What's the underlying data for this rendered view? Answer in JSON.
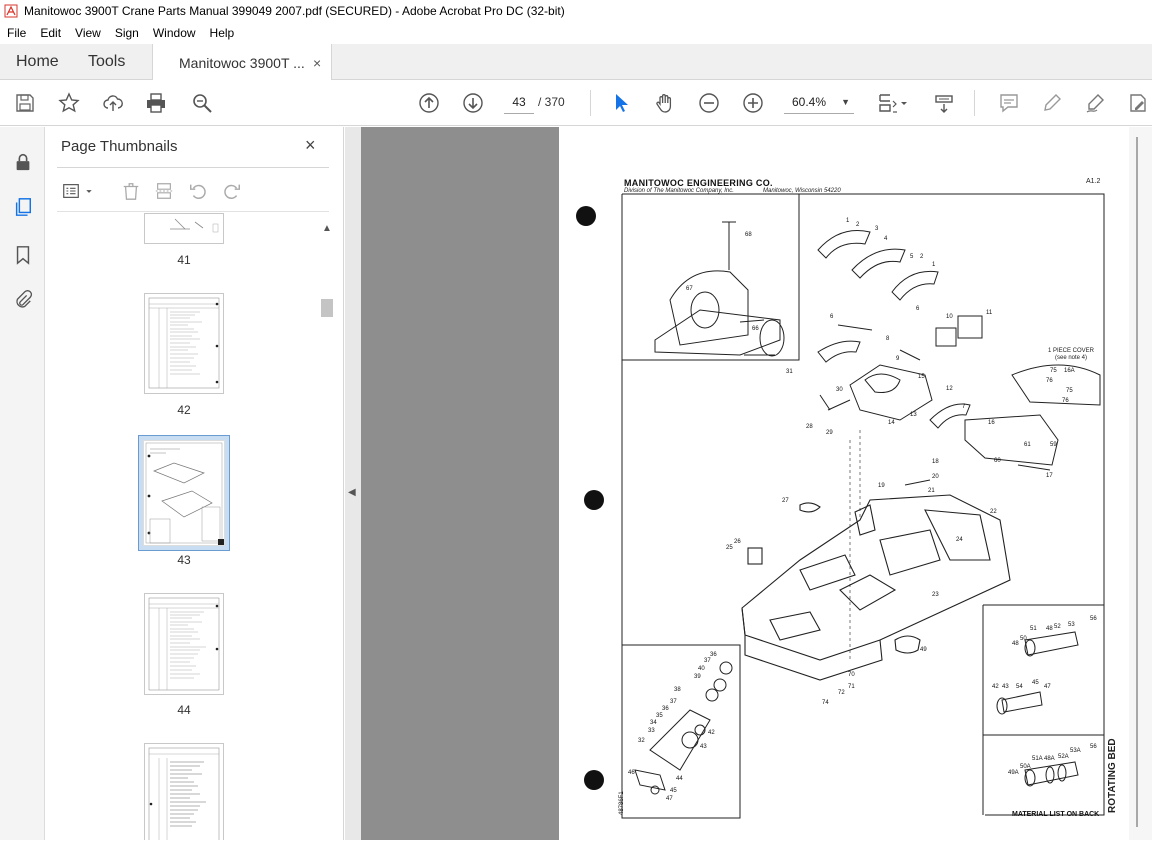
{
  "window": {
    "title": "Manitowoc 3900T Crane Parts Manual 399049 2007.pdf (SECURED) - Adobe Acrobat Pro DC (32-bit)"
  },
  "menu": [
    "File",
    "Edit",
    "View",
    "Sign",
    "Window",
    "Help"
  ],
  "tabs": {
    "home": "Home",
    "tools": "Tools",
    "doc": "Manitowoc 3900T ...",
    "close": "×"
  },
  "toolbar": {
    "page_current": "43",
    "page_total": "/ 370",
    "zoom": "60.4%"
  },
  "icons": {
    "save": "save-icon",
    "bookmark": "star-icon",
    "upload": "upload-icon",
    "print": "print-icon",
    "search": "zoom-search-icon",
    "prev": "page-up-icon",
    "next": "page-down-icon",
    "select": "cursor-icon",
    "hand": "hand-icon",
    "zoom_out": "zoom-out-icon",
    "zoom_in": "zoom-in-icon",
    "fit": "fit-page-icon",
    "scroll": "scroll-mode-icon",
    "comment": "comment-icon",
    "highlight": "highlight-icon",
    "sign": "sign-icon",
    "edit": "edit-pdf-icon"
  },
  "panel": {
    "title": "Page Thumbnails",
    "close": "×",
    "thumbnails": [
      {
        "num": "41"
      },
      {
        "num": "42"
      },
      {
        "num": "43",
        "selected": true
      },
      {
        "num": "44"
      },
      {
        "num": ""
      }
    ]
  },
  "page": {
    "company": "MANITOWOC ENGINEERING CO.",
    "division": "Division of The Manitowoc Company, Inc.",
    "location": "Manitowoc, Wisconsin 54220",
    "code": "A1.2",
    "section_title": "ROTATING BED",
    "material_note": "MATERIAL LIST ON BACK",
    "drawing_no": "48786F1",
    "cover_note_1": "1 PIECE COVER",
    "cover_note_2": "(see note 4)",
    "callouts": [
      "68",
      "67",
      "66",
      "1",
      "2",
      "3",
      "4",
      "5",
      "6",
      "10",
      "11",
      "9",
      "8",
      "31",
      "30",
      "15",
      "12",
      "13",
      "14",
      "28",
      "29",
      "7",
      "16",
      "61",
      "59",
      "60",
      "17",
      "75",
      "16A",
      "76",
      "18",
      "19",
      "20",
      "21",
      "27",
      "22",
      "26",
      "25",
      "24",
      "23",
      "49",
      "70",
      "71",
      "72",
      "74",
      "36",
      "37",
      "40",
      "39",
      "38",
      "37",
      "36",
      "35",
      "34",
      "33",
      "32",
      "42",
      "43",
      "46",
      "44",
      "45",
      "47",
      "51",
      "48",
      "52",
      "53",
      "56",
      "50",
      "54",
      "55",
      "57",
      "51A",
      "52A",
      "53A",
      "50A",
      "49A",
      "48A"
    ]
  },
  "colors": {
    "accent": "#1473e6",
    "viewer_bg": "#8e8e8e",
    "selected_thumb": "#c9ddf2"
  }
}
